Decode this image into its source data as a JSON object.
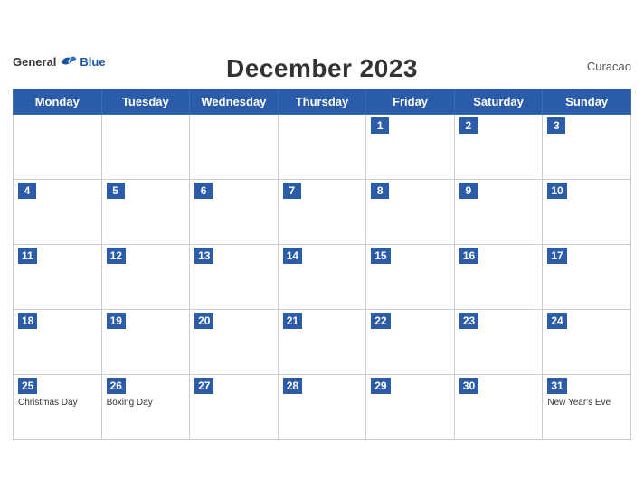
{
  "header": {
    "title": "December 2023",
    "country": "Curacao",
    "logo_general": "General",
    "logo_blue": "Blue"
  },
  "weekdays": [
    "Monday",
    "Tuesday",
    "Wednesday",
    "Thursday",
    "Friday",
    "Saturday",
    "Sunday"
  ],
  "weeks": [
    [
      {
        "day": "",
        "holiday": ""
      },
      {
        "day": "",
        "holiday": ""
      },
      {
        "day": "",
        "holiday": ""
      },
      {
        "day": "",
        "holiday": ""
      },
      {
        "day": "1",
        "holiday": ""
      },
      {
        "day": "2",
        "holiday": ""
      },
      {
        "day": "3",
        "holiday": ""
      }
    ],
    [
      {
        "day": "4",
        "holiday": ""
      },
      {
        "day": "5",
        "holiday": ""
      },
      {
        "day": "6",
        "holiday": ""
      },
      {
        "day": "7",
        "holiday": ""
      },
      {
        "day": "8",
        "holiday": ""
      },
      {
        "day": "9",
        "holiday": ""
      },
      {
        "day": "10",
        "holiday": ""
      }
    ],
    [
      {
        "day": "11",
        "holiday": ""
      },
      {
        "day": "12",
        "holiday": ""
      },
      {
        "day": "13",
        "holiday": ""
      },
      {
        "day": "14",
        "holiday": ""
      },
      {
        "day": "15",
        "holiday": ""
      },
      {
        "day": "16",
        "holiday": ""
      },
      {
        "day": "17",
        "holiday": ""
      }
    ],
    [
      {
        "day": "18",
        "holiday": ""
      },
      {
        "day": "19",
        "holiday": ""
      },
      {
        "day": "20",
        "holiday": ""
      },
      {
        "day": "21",
        "holiday": ""
      },
      {
        "day": "22",
        "holiday": ""
      },
      {
        "day": "23",
        "holiday": ""
      },
      {
        "day": "24",
        "holiday": ""
      }
    ],
    [
      {
        "day": "25",
        "holiday": "Christmas Day"
      },
      {
        "day": "26",
        "holiday": "Boxing Day"
      },
      {
        "day": "27",
        "holiday": ""
      },
      {
        "day": "28",
        "holiday": ""
      },
      {
        "day": "29",
        "holiday": ""
      },
      {
        "day": "30",
        "holiday": ""
      },
      {
        "day": "31",
        "holiday": "New Year's Eve"
      }
    ]
  ]
}
